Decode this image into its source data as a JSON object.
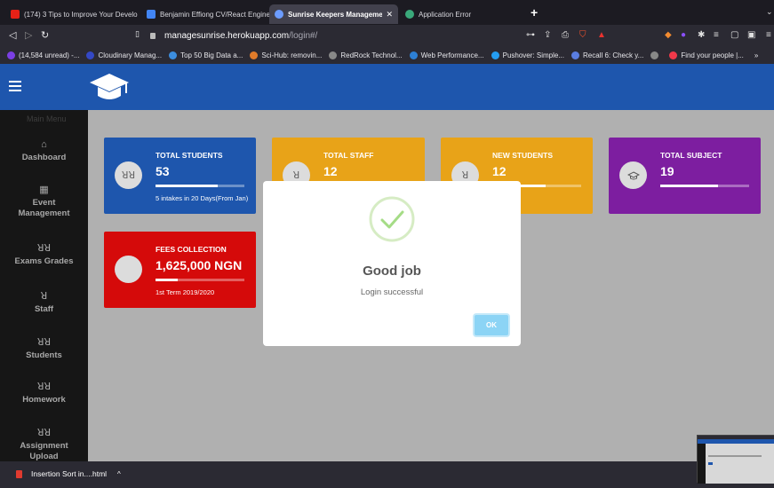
{
  "tabs": [
    {
      "label": "(174) 3 Tips to Improve Your Develo",
      "icon": "youtube-icon",
      "color": "#e62117"
    },
    {
      "label": "Benjamin Effiong CV/React Enginee",
      "icon": "docs-icon",
      "color": "#4285f4"
    },
    {
      "label": "Sunrise Keepers Management S",
      "icon": "app-icon",
      "color": "#6c9cff",
      "active": true
    },
    {
      "label": "Application Error",
      "icon": "heroku-icon",
      "color": "#3aa87a"
    }
  ],
  "address": {
    "domain": "managesunrise.herokuapp.com",
    "path": "/login#/"
  },
  "bookmarks": [
    {
      "label": "(14,584 unread) -...",
      "color": "#7b3fe4"
    },
    {
      "label": "Cloudinary Manag...",
      "color": "#3448c5"
    },
    {
      "label": "Top 50 Big Data a...",
      "color": "#3c8dde"
    },
    {
      "label": "Sci-Hub: removin...",
      "color": "#e07b2a"
    },
    {
      "label": "RedRock Technol...",
      "color": "#888888"
    },
    {
      "label": "Web Performance...",
      "color": "#2d7fd4"
    },
    {
      "label": "Pushover: Simple...",
      "color": "#249df1"
    },
    {
      "label": "Recall 6: Check y...",
      "color": "#5a7de0"
    },
    {
      "label": "",
      "color": "#888888"
    },
    {
      "label": "Find your people |...",
      "color": "#f0394a"
    }
  ],
  "sidebar": {
    "title": "Main Menu",
    "items": [
      {
        "label": "Dashboard",
        "icon": "home-icon",
        "glyph": "⌂"
      },
      {
        "label": "Event Management",
        "icon": "calendar-icon",
        "glyph": "▦"
      },
      {
        "label": "Exams Grades",
        "icon": "users-icon",
        "glyph": "ꓤꓤ"
      },
      {
        "label": "Staff",
        "icon": "user-icon",
        "glyph": "ꓤ"
      },
      {
        "label": "Students",
        "icon": "users-icon",
        "glyph": "ꓤꓤ"
      },
      {
        "label": "Homework",
        "icon": "users-icon",
        "glyph": "ꓤꓤ"
      },
      {
        "label": "Assignment Upload",
        "icon": "users-icon",
        "glyph": "ꓤꓤ"
      }
    ]
  },
  "cards": [
    {
      "title": "TOTAL STUDENTS",
      "value": "53",
      "sub": "5 intakes in 20 Days(From Jan)",
      "color": "#1e56ad",
      "icon": "users-icon",
      "glyph": "ꓤꓤ",
      "progress": 0.7
    },
    {
      "title": "TOTAL STAFF",
      "value": "12",
      "sub": "",
      "color": "#e8a318",
      "icon": "user-icon",
      "glyph": "ꓤ",
      "progress": 0.6
    },
    {
      "title": "NEW STUDENTS",
      "value": "12",
      "sub": "",
      "color": "#e8a318",
      "icon": "user-icon",
      "glyph": "ꓤ",
      "progress": 0.6
    },
    {
      "title": "TOTAL SUBJECT",
      "value": "19",
      "sub": "",
      "color": "#7d1ea0",
      "icon": "graduation-cap-icon",
      "glyph": "🎓",
      "progress": 0.65
    },
    {
      "title": "FEES COLLECTION",
      "value": "1,625,000 NGN",
      "sub": "1st Term 2019/2020",
      "color": "#d50a0a",
      "icon": "money-icon",
      "glyph": "",
      "progress": 0.25
    }
  ],
  "modal": {
    "title": "Good job",
    "text": "Login successful",
    "ok_label": "OK"
  },
  "download": {
    "label": "Insertion Sort in....html"
  }
}
